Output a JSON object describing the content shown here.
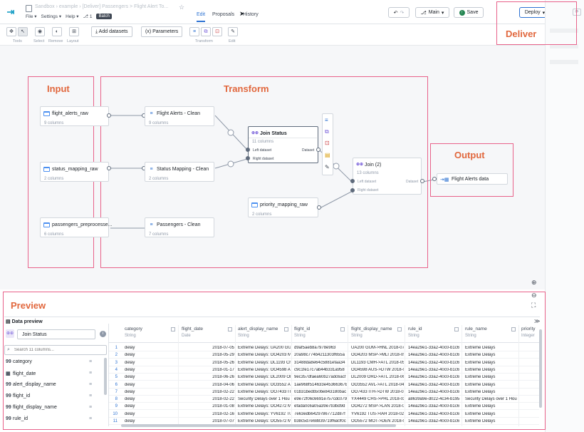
{
  "header": {
    "logo_glyph": "⇥",
    "breadcrumb": "Sandbox › example › [Deliver] Passengers > Flight Alert To...",
    "menus": [
      "File ▾",
      "Settings ▾",
      "Help ▾"
    ],
    "branch_count": "1",
    "batch_label": "Batch",
    "tabs": [
      "Edit",
      "Proposals",
      "History"
    ],
    "branch_label": "Main",
    "save_label": "Save",
    "deploy_label": "Deploy"
  },
  "toolbar": {
    "groups": [
      "Tools",
      "Select",
      "Remove",
      "Layout",
      "Transform",
      "Edit"
    ],
    "add_datasets": "Add datasets",
    "parameters": "Parameters"
  },
  "annotations": {
    "deliver": "Deliver",
    "input": "Input",
    "transform": "Transform",
    "output": "Output",
    "preview": "Preview"
  },
  "nodes": {
    "flight_alerts_raw": {
      "title": "flight_alerts_raw",
      "sub": "9 columns"
    },
    "status_mapping_raw": {
      "title": "status_mapping_raw",
      "sub": "2 columns"
    },
    "passengers_preprocessed": {
      "title": "passengers_preprocesse...",
      "sub": "6 columns"
    },
    "flight_alerts_clean": {
      "title": "Flight Alerts - Clean",
      "sub": "9 columns"
    },
    "status_mapping_clean": {
      "title": "Status Mapping - Clean",
      "sub": "2 columns"
    },
    "passengers_clean": {
      "title": "Passengers - Clean",
      "sub": "7 columns"
    },
    "join_status": {
      "title": "Join Status",
      "sub": "11 columns",
      "left": "Left dataset",
      "right": "Right dataset",
      "out": "Dataset"
    },
    "priority_mapping_raw": {
      "title": "priority_mapping_raw",
      "sub": "2 columns"
    },
    "join2": {
      "title": "Join (2)",
      "sub": "13 columns",
      "left": "Left dataset",
      "right": "Right dataset",
      "out": "Dataset"
    },
    "output": {
      "title": "Flight Alerts data"
    }
  },
  "preview": {
    "title": "Data preview",
    "selected_node": "Join Status",
    "search_placeholder": "Search 11 columns...",
    "schema": [
      {
        "icon": "99",
        "name": "category"
      },
      {
        "icon": "▦",
        "name": "flight_date"
      },
      {
        "icon": "99",
        "name": "alert_display_name"
      },
      {
        "icon": "99",
        "name": "flight_id"
      },
      {
        "icon": "99",
        "name": "flight_display_name"
      },
      {
        "icon": "99",
        "name": "rule_id"
      }
    ],
    "columns": [
      {
        "name": "category",
        "type": "String"
      },
      {
        "name": "flight_date",
        "type": "Date"
      },
      {
        "name": "alert_display_name",
        "type": "String"
      },
      {
        "name": "flight_id",
        "type": "String"
      },
      {
        "name": "flight_display_name",
        "type": "String"
      },
      {
        "name": "rule_id",
        "type": "String"
      },
      {
        "name": "rule_name",
        "type": "String"
      },
      {
        "name": "priority",
        "type": "Integer"
      }
    ],
    "rows": [
      [
        "1",
        "delay",
        "2018-07-05",
        "Extreme Delays: UA200 GUI",
        "d9af5aeb8a7978e963",
        "UA200 GUM->HNL 2018-07-",
        "14ea29e1-33a2-40c0-b1c6",
        "Extreme Delays"
      ],
      [
        "2",
        "delay",
        "2018-05-29",
        "Extreme Delays: OO4203 M",
        "20a98c774b4211303f655a",
        "OO4203 MSP->MLI 2018-05",
        "14ea29e1-33a2-40c0-b1c6",
        "Extreme Delays"
      ],
      [
        "3",
        "delay",
        "2018-05-26",
        "Extreme Delays: DL1193 Ch",
        "31488da8e64c5881efaa34",
        "DL1193 CMH->ATL 2018-05",
        "14ea29e1-33a2-40c0-b1c6",
        "Extreme Delays"
      ],
      [
        "4",
        "delay",
        "2018-01-17",
        "Extreme Delays: OO4598 At",
        "c9c1fe17c7ab44b331a958",
        "OO4598 AUS->DTW 2018-01",
        "14ea29e1-33a2-40c0-b1c6",
        "Extreme Delays"
      ],
      [
        "5",
        "delay",
        "2018-06-26",
        "Extreme Delays: DL2009 OF",
        "9ec357dfaea60b27adc6acf",
        "DL2009 ORD->ATL 2018-06-",
        "14ea29e1-33a2-40c0-b1c6",
        "Extreme Delays"
      ],
      [
        "6",
        "delay",
        "2018-04-06",
        "Extreme Delays: OO3552 Al",
        "1ae968f514633e45366367E",
        "OO3552 AVL->ATL 2018-04",
        "14ea29e1-33a2-40c0-b1c6",
        "Extreme Delays"
      ],
      [
        "7",
        "delay",
        "2018-02-22",
        "Extreme Delays: OO7433 IT",
        "01b31bedb50be843180bac",
        "OO7433 ITH->DTW 2018-02",
        "14ea29e1-33a2-40c0-b1c6",
        "Extreme Delays"
      ],
      [
        "8",
        "delay",
        "2018-02-22",
        "Security Delays over 1 Hou",
        "e9e72f06c6691e757cdc079",
        "YX4449 CHS->PHL 2018-02-",
        "a8639a9e-d022-4c34-b195",
        "Security Delays over 1 Hou"
      ],
      [
        "9",
        "delay",
        "2018-01-08",
        "Extreme Delays: OO4272 M",
        "efada0c6a05a39e7b3bd9d",
        "OO4272 MSP->LAN 2018-01",
        "14ea29e1-33a2-40c0-b1c6",
        "Extreme Delays"
      ],
      [
        "10",
        "delay",
        "2018-02-16",
        "Extreme Delays: YV6192 TU",
        "7e63edb64297867712d87f",
        "YV6192 TUS->IAH 2018-02-",
        "14ea29e1-33a2-40c0-b1c6",
        "Extreme Delays"
      ],
      [
        "11",
        "delay",
        "2018-07-07",
        "Extreme Delays: OO5572 M",
        "b38c5d7e68839719f6a0f0c",
        "OO5572 MOT->DEN 2018-07",
        "14ea29e1-33a2-40c0-b1c6",
        "Extreme Delays"
      ]
    ]
  }
}
